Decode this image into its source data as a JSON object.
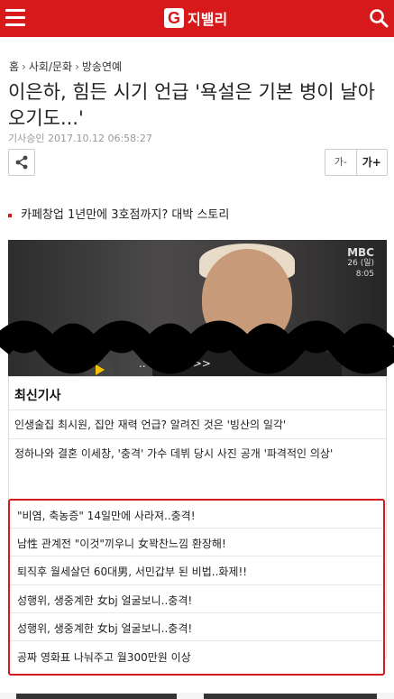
{
  "header": {
    "logo_letter": "G",
    "logo_text": "지밸리",
    "menu_icon": "hamburger-icon",
    "search_icon": "search-icon",
    "brand_color": "#d7191c"
  },
  "breadcrumb": {
    "home": "홈",
    "category": "사회/문화",
    "subcategory": "방송연예"
  },
  "article": {
    "title": "이은하, 힘든 시기 언급 '욕설은 기본 병이 날아오기도...'",
    "date": "기사승인 2017.10.12  06:58:27"
  },
  "toolbar": {
    "share_icon": "share-icon",
    "font_smaller": "가-",
    "font_larger": "가+"
  },
  "promo": {
    "text": "카페창업 1년만에 3호점까지? 대박 스토리"
  },
  "video": {
    "channel": "MBC",
    "overlay_date": "26 (일)",
    "overlay_time": "8:05",
    "cta": "..ㅎ 확인  ..  >>"
  },
  "latest": {
    "title": "최신기사",
    "items": [
      "인생술집 최시원, 집안 재력 언급? 알려진 것은 '빙산의 일각'",
      "정하나와 결혼 이세창, '충격' 가수 데뷔 당시 사진 공개 '파격적인 의상'"
    ]
  },
  "ads": {
    "items": [
      "\"비염, 축농증\" 14일만에 사라져..충격!",
      "남性 관계전 \"이것\"끼우니 女꽉찬느낌 환장해!",
      "퇴직후 월세살던 60대男, 서민갑부 된 비법..화제!!",
      "성행위, 생중계한 女bj 얼굴보니..충격!",
      "성행위, 생중계한 女bj 얼굴보니..충격!",
      "공짜 영화표 나눠주고 월300만원 이상"
    ]
  }
}
